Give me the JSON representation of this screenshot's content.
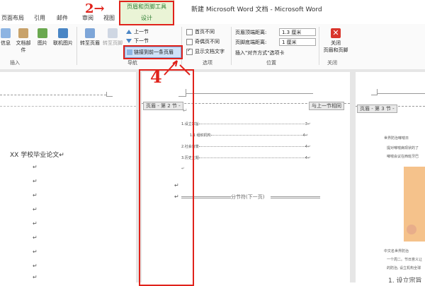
{
  "window": {
    "title": "新建 Microsoft Word 文档 - Microsoft Word"
  },
  "tabs": [
    "页面布局",
    "引用",
    "邮件",
    "审阅",
    "视图"
  ],
  "context_tab": {
    "group": "页眉和页脚工具",
    "tab": "设计"
  },
  "ribbon": {
    "insert_group": {
      "buttons": [
        "信息",
        "文档部件",
        "图片",
        "联机图片"
      ],
      "label": "插入"
    },
    "nav_group": {
      "goto_header": "转至页眉",
      "goto_footer": "转至页脚",
      "prev_section": "上一节",
      "next_section": "下一节",
      "link_prev": "链接到前一条页眉",
      "label": "导航"
    },
    "options_group": {
      "first_page": "首页不同",
      "odd_even": "奇偶页不同",
      "show_text": "显示文档文字",
      "label": "选项"
    },
    "position_group": {
      "header_top": "页眉顶端距离:",
      "header_top_val": "1.3 厘米",
      "footer_bottom": "页脚底端距离:",
      "footer_bottom_val": "1 厘米",
      "insert_align": "插入\"对齐方式\"选项卡",
      "label": "位置"
    },
    "close_group": {
      "close_line1": "关闭",
      "close_line2": "页眉和页脚",
      "label": "关闭"
    }
  },
  "pages": {
    "p1": {
      "title": "XX 学校毕业论文↵"
    },
    "p2": {
      "header_tag": "页眉 - 第 2 节 -",
      "same_as_prev": "与上一节相同",
      "header_mark": "↵",
      "toc": [
        {
          "text": "1.设立宗旨",
          "page": "3↵"
        },
        {
          "text": "1.1 组织机构",
          "page": "4↵"
        },
        {
          "text": "2.社会背景",
          "page": "4↵"
        },
        {
          "text": "3.历史主题",
          "page": "4↵"
        }
      ],
      "section_break": "分节符(下一页)"
    },
    "p3": {
      "header_tag": "页眉 - 第 3 节 -",
      "lines": [
        "世界防治哮喘日",
        "提对哮喘病现状的了",
        "哮喘会议在西班牙巴"
      ],
      "lines2": [
        "中文名世界防治",
        "一个周二。节日意义让",
        "的防治, 设立机构全球"
      ],
      "heading": "1. 设立宗旨"
    }
  },
  "annotations": {
    "two": "2→",
    "four": "4"
  }
}
